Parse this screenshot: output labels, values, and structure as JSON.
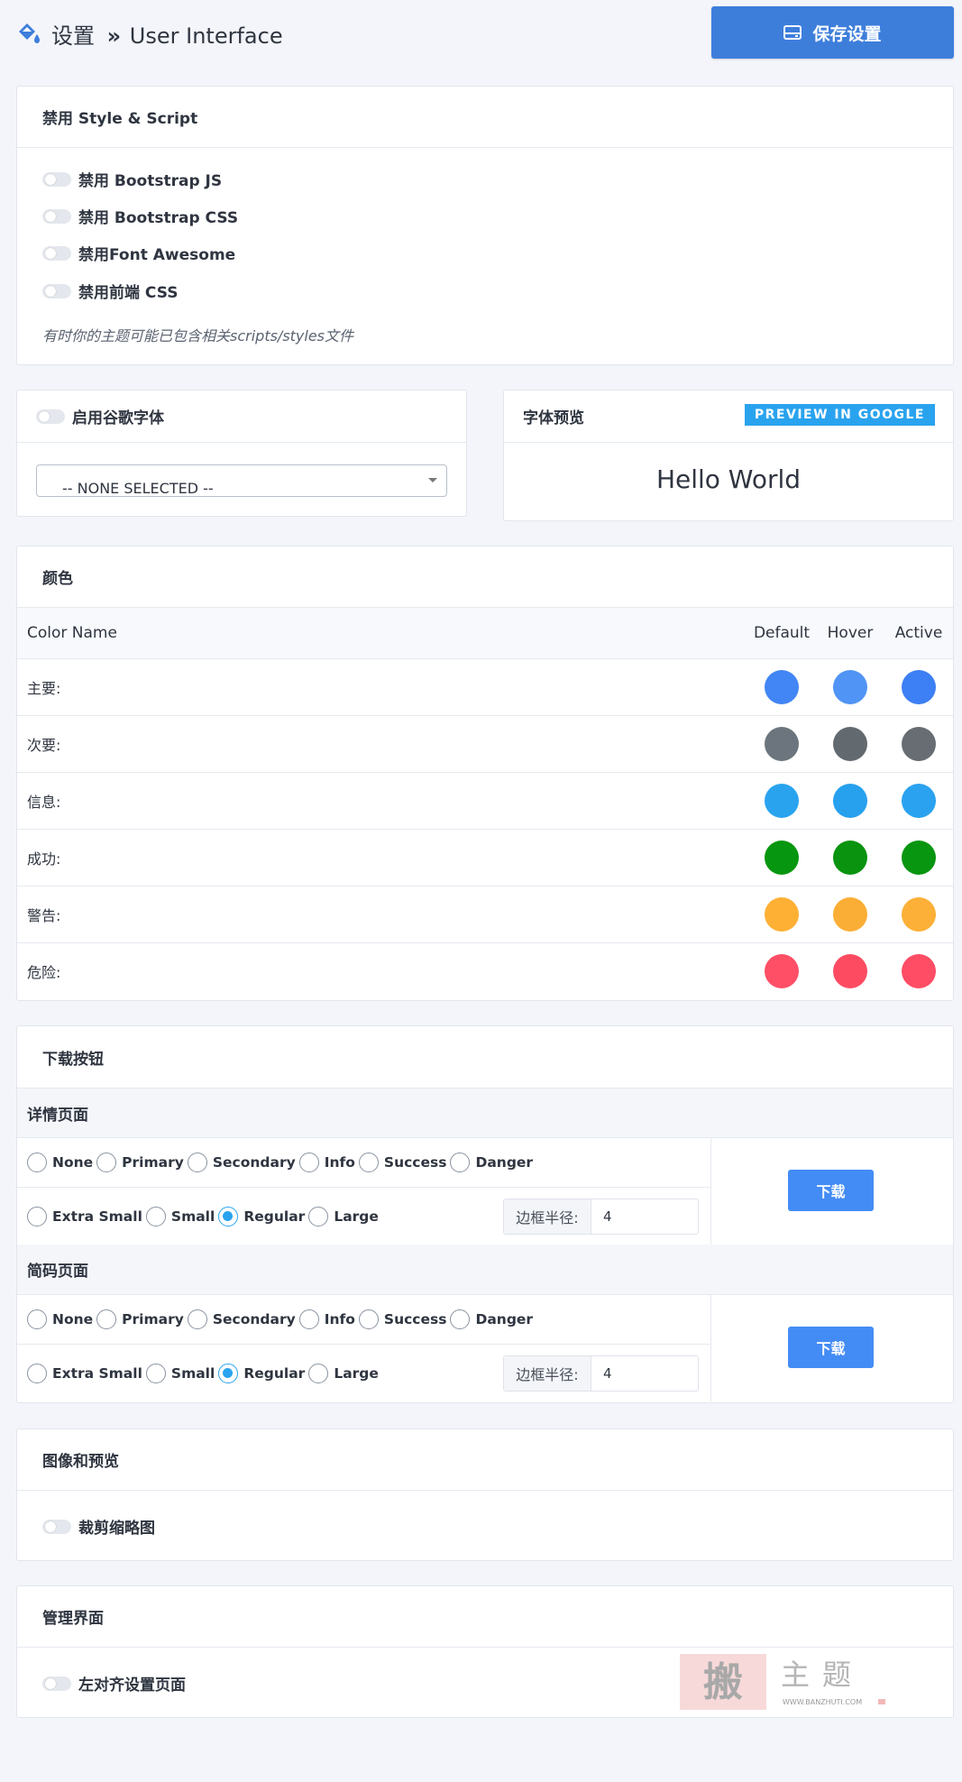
{
  "header": {
    "breadcrumb_root": "设置",
    "breadcrumb_separator": "»",
    "breadcrumb_current": "User Interface",
    "save_label": "保存设置"
  },
  "disable_section": {
    "title": "禁用 Style & Script",
    "options": [
      "禁用 Bootstrap JS",
      "禁用 Bootstrap CSS",
      "禁用Font Awesome",
      "禁用前端 CSS"
    ],
    "note": "有时你的主题可能已包含相关scripts/styles文件"
  },
  "google_fonts": {
    "toggle_label": "启用谷歌字体",
    "select_value": "-- NONE SELECTED --"
  },
  "font_preview": {
    "title": "字体预览",
    "preview_link": "PREVIEW IN GOOGLE",
    "sample_text": "Hello World"
  },
  "colors_section": {
    "title": "颜色",
    "columns": [
      "Color Name",
      "Default",
      "Hover",
      "Active"
    ],
    "rows": [
      {
        "name": "主要:",
        "default": "#4285f4",
        "hover": "#5094f5",
        "active": "#3d7ff4"
      },
      {
        "name": "次要:",
        "default": "#6c757d",
        "hover": "#62696f",
        "active": "#686d73"
      },
      {
        "name": "信息:",
        "default": "#2aa3ef",
        "hover": "#27a0ee",
        "active": "#2ba2ef"
      },
      {
        "name": "成功:",
        "default": "#07960f",
        "hover": "#09930f",
        "active": "#089510"
      },
      {
        "name": "警告:",
        "default": "#feb035",
        "hover": "#fbae36",
        "active": "#fcb038"
      },
      {
        "name": "危险:",
        "default": "#fe4f66",
        "hover": "#fd4c62",
        "active": "#fe4d64"
      }
    ]
  },
  "download_section": {
    "title": "下载按钮",
    "groups": [
      {
        "title": "详情页面",
        "styles": [
          "None",
          "Primary",
          "Secondary",
          "Info",
          "Success",
          "Danger"
        ],
        "selected_style": "",
        "sizes": [
          "Extra Small",
          "Small",
          "Regular",
          "Large"
        ],
        "selected_size": "Regular",
        "radius_label": "边框半径:",
        "radius_value": "4",
        "button_label": "下载"
      },
      {
        "title": "简码页面",
        "styles": [
          "None",
          "Primary",
          "Secondary",
          "Info",
          "Success",
          "Danger"
        ],
        "selected_style": "",
        "sizes": [
          "Extra Small",
          "Small",
          "Regular",
          "Large"
        ],
        "selected_size": "Regular",
        "radius_label": "边框半径:",
        "radius_value": "4",
        "button_label": "下载"
      }
    ]
  },
  "image_section": {
    "title": "图像和预览",
    "toggle_label": "裁剪缩略图"
  },
  "admin_section": {
    "title": "管理界面",
    "toggle_label": "左对齐设置页面"
  },
  "watermark": {
    "text": "搬主题",
    "url": "WWW.BANZHUTI.COM"
  }
}
